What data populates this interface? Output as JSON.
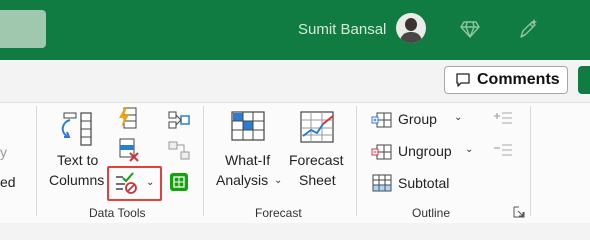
{
  "titlebar": {
    "user_name": "Sumit Bansal",
    "icons": [
      "premium-diamond-icon",
      "designer-pen-icon"
    ]
  },
  "commandbar": {
    "comments_label": "Comments"
  },
  "ribbon": {
    "left_partial": {
      "line1": "y",
      "line2": "ed"
    },
    "data_tools": {
      "group_label": "Data Tools",
      "text_to_columns": {
        "line1": "Text to",
        "line2": "Columns"
      },
      "icons": [
        "flash-fill-icon",
        "remove-duplicates-icon",
        "data-validation-icon",
        "consolidate-icon",
        "relationships-icon",
        "manage-data-model-icon"
      ]
    },
    "forecast": {
      "group_label": "Forecast",
      "what_if": {
        "line1": "What-If",
        "line2": "Analysis"
      },
      "forecast_sheet": {
        "line1": "Forecast",
        "line2": "Sheet"
      }
    },
    "outline": {
      "group_label": "Outline",
      "group": "Group",
      "ungroup": "Ungroup",
      "subtotal": "Subtotal"
    }
  },
  "colors": {
    "title_bar": "#107c41",
    "highlight_box": "#e2403b"
  }
}
